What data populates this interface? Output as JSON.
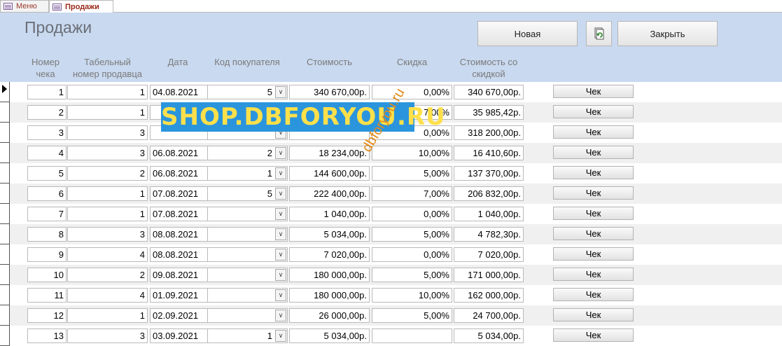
{
  "tabs": [
    {
      "label": "Меню",
      "active": false
    },
    {
      "label": "Продажи",
      "active": true
    }
  ],
  "form": {
    "title": "Продажи",
    "buttons": {
      "new": "Новая",
      "close": "Закрыть",
      "refresh_icon": "refresh-icon"
    }
  },
  "columns": {
    "check_no": "Номер\nчека",
    "seller_id": "Табельный\nномер продавца",
    "date": "Дата",
    "customer": "Код покупателя",
    "cost": "Стоимость",
    "discount": "Скидка",
    "discounted": "Стоимость со\nскидкой"
  },
  "rows": [
    {
      "check_no": "1",
      "seller_id": "1",
      "date": "04.08.2021",
      "customer": "5",
      "cost": "340 670,00р.",
      "discount": "0,00%",
      "discounted": "340 670,00р.",
      "action": "Чек"
    },
    {
      "check_no": "2",
      "seller_id": "1",
      "date": "",
      "customer": "",
      "cost": "",
      "discount": "7,00%",
      "discounted": "35 985,42р.",
      "action": "Чек"
    },
    {
      "check_no": "3",
      "seller_id": "3",
      "date": "",
      "customer": "",
      "cost": "",
      "discount": "0,00%",
      "discounted": "318 200,00р.",
      "action": "Чек"
    },
    {
      "check_no": "4",
      "seller_id": "3",
      "date": "06.08.2021",
      "customer": "2",
      "cost": "18 234,00р.",
      "discount": "10,00%",
      "discounted": "16 410,60р.",
      "action": "Чек"
    },
    {
      "check_no": "5",
      "seller_id": "2",
      "date": "06.08.2021",
      "customer": "1",
      "cost": "144 600,00р.",
      "discount": "5,00%",
      "discounted": "137 370,00р.",
      "action": "Чек"
    },
    {
      "check_no": "6",
      "seller_id": "1",
      "date": "07.08.2021",
      "customer": "5",
      "cost": "222 400,00р.",
      "discount": "7,00%",
      "discounted": "206 832,00р.",
      "action": "Чек"
    },
    {
      "check_no": "7",
      "seller_id": "1",
      "date": "07.08.2021",
      "customer": "",
      "cost": "1 040,00р.",
      "discount": "0,00%",
      "discounted": "1 040,00р.",
      "action": "Чек"
    },
    {
      "check_no": "8",
      "seller_id": "3",
      "date": "08.08.2021",
      "customer": "",
      "cost": "5 034,00р.",
      "discount": "5,00%",
      "discounted": "4 782,30р.",
      "action": "Чек"
    },
    {
      "check_no": "9",
      "seller_id": "4",
      "date": "08.08.2021",
      "customer": "",
      "cost": "7 020,00р.",
      "discount": "0,00%",
      "discounted": "7 020,00р.",
      "action": "Чек"
    },
    {
      "check_no": "10",
      "seller_id": "2",
      "date": "09.08.2021",
      "customer": "",
      "cost": "180 000,00р.",
      "discount": "5,00%",
      "discounted": "171 000,00р.",
      "action": "Чек"
    },
    {
      "check_no": "11",
      "seller_id": "4",
      "date": "01.09.2021",
      "customer": "",
      "cost": "180 000,00р.",
      "discount": "10,00%",
      "discounted": "162 000,00р.",
      "action": "Чек"
    },
    {
      "check_no": "12",
      "seller_id": "1",
      "date": "02.09.2021",
      "customer": "",
      "cost": "26 000,00р.",
      "discount": "5,00%",
      "discounted": "24 700,00р.",
      "action": "Чек"
    },
    {
      "check_no": "13",
      "seller_id": "3",
      "date": "03.09.2021",
      "customer": "1",
      "cost": "5 034,00р.",
      "discount": "",
      "discounted": "5 034,00р.",
      "action": "Чек"
    }
  ],
  "watermark": {
    "banner": "SHOP.DBFORYOU.RU",
    "diagonal": "dbforyou.ru",
    "banner_bg": "#2a95dc",
    "banner_fg": "#ffe04a",
    "diagonal_color": "#e38a1a"
  },
  "colors": {
    "header_bg": "#c9d9ef",
    "tab_text": "#9a2a1a",
    "alt_row": "#f0f0f0"
  }
}
